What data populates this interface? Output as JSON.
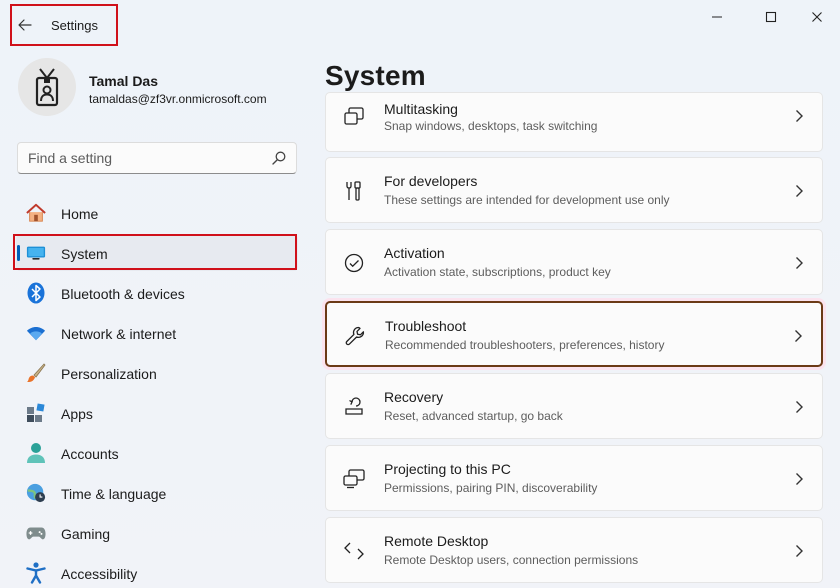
{
  "window": {
    "title": "Settings",
    "back_icon": "arrow-left-icon",
    "controls": [
      "minimize-icon",
      "maximize-icon",
      "close-icon"
    ]
  },
  "profile": {
    "name": "Tamal Das",
    "email": "tamaldas@zf3vr.onmicrosoft.com",
    "avatar_icon": "id-badge-icon"
  },
  "search": {
    "placeholder": "Find a setting",
    "icon": "search-icon"
  },
  "sidebar": {
    "items": [
      {
        "label": "Home",
        "icon": "home-icon"
      },
      {
        "label": "System",
        "icon": "monitor-icon",
        "active": true
      },
      {
        "label": "Bluetooth & devices",
        "icon": "bluetooth-icon"
      },
      {
        "label": "Network & internet",
        "icon": "wifi-icon"
      },
      {
        "label": "Personalization",
        "icon": "paintbrush-icon"
      },
      {
        "label": "Apps",
        "icon": "apps-icon"
      },
      {
        "label": "Accounts",
        "icon": "person-icon"
      },
      {
        "label": "Time & language",
        "icon": "globe-clock-icon"
      },
      {
        "label": "Gaming",
        "icon": "gamepad-icon"
      },
      {
        "label": "Accessibility",
        "icon": "accessibility-icon"
      }
    ]
  },
  "main": {
    "title": "System",
    "cards": [
      {
        "title": "Multitasking",
        "desc": "Snap windows, desktops, task switching",
        "icon": "multitasking-icon"
      },
      {
        "title": "For developers",
        "desc": "These settings are intended for development use only",
        "icon": "developer-tools-icon"
      },
      {
        "title": "Activation",
        "desc": "Activation state, subscriptions, product key",
        "icon": "check-circle-icon"
      },
      {
        "title": "Troubleshoot",
        "desc": "Recommended troubleshooters, preferences, history",
        "icon": "wrench-icon",
        "highlighted": true
      },
      {
        "title": "Recovery",
        "desc": "Reset, advanced startup, go back",
        "icon": "recovery-icon"
      },
      {
        "title": "Projecting to this PC",
        "desc": "Permissions, pairing PIN, discoverability",
        "icon": "projecting-icon"
      },
      {
        "title": "Remote Desktop",
        "desc": "Remote Desktop users, connection permissions",
        "icon": "remote-desktop-icon"
      }
    ]
  },
  "colors": {
    "accent": "#005fb8",
    "highlight_red": "#d0101a",
    "highlight_brown": "#6b3a16"
  }
}
